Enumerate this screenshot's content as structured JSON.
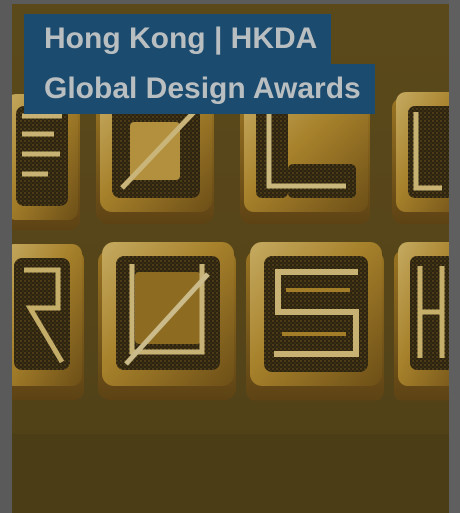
{
  "card": {
    "title_line1": "Hong Kong | HKDA",
    "title_line2": "Global Design Awards"
  },
  "image": {
    "subject": "gold-rush-lettering",
    "letters_top": [
      "G",
      "O",
      "L",
      "D"
    ],
    "letters_bottom": [
      "R",
      "U",
      "S",
      "H"
    ]
  },
  "colors": {
    "title_bg": "#1b4b6e",
    "title_text": "#b9bec1",
    "gold": "#c49a2b",
    "page_bg": "#5a5a5a"
  }
}
